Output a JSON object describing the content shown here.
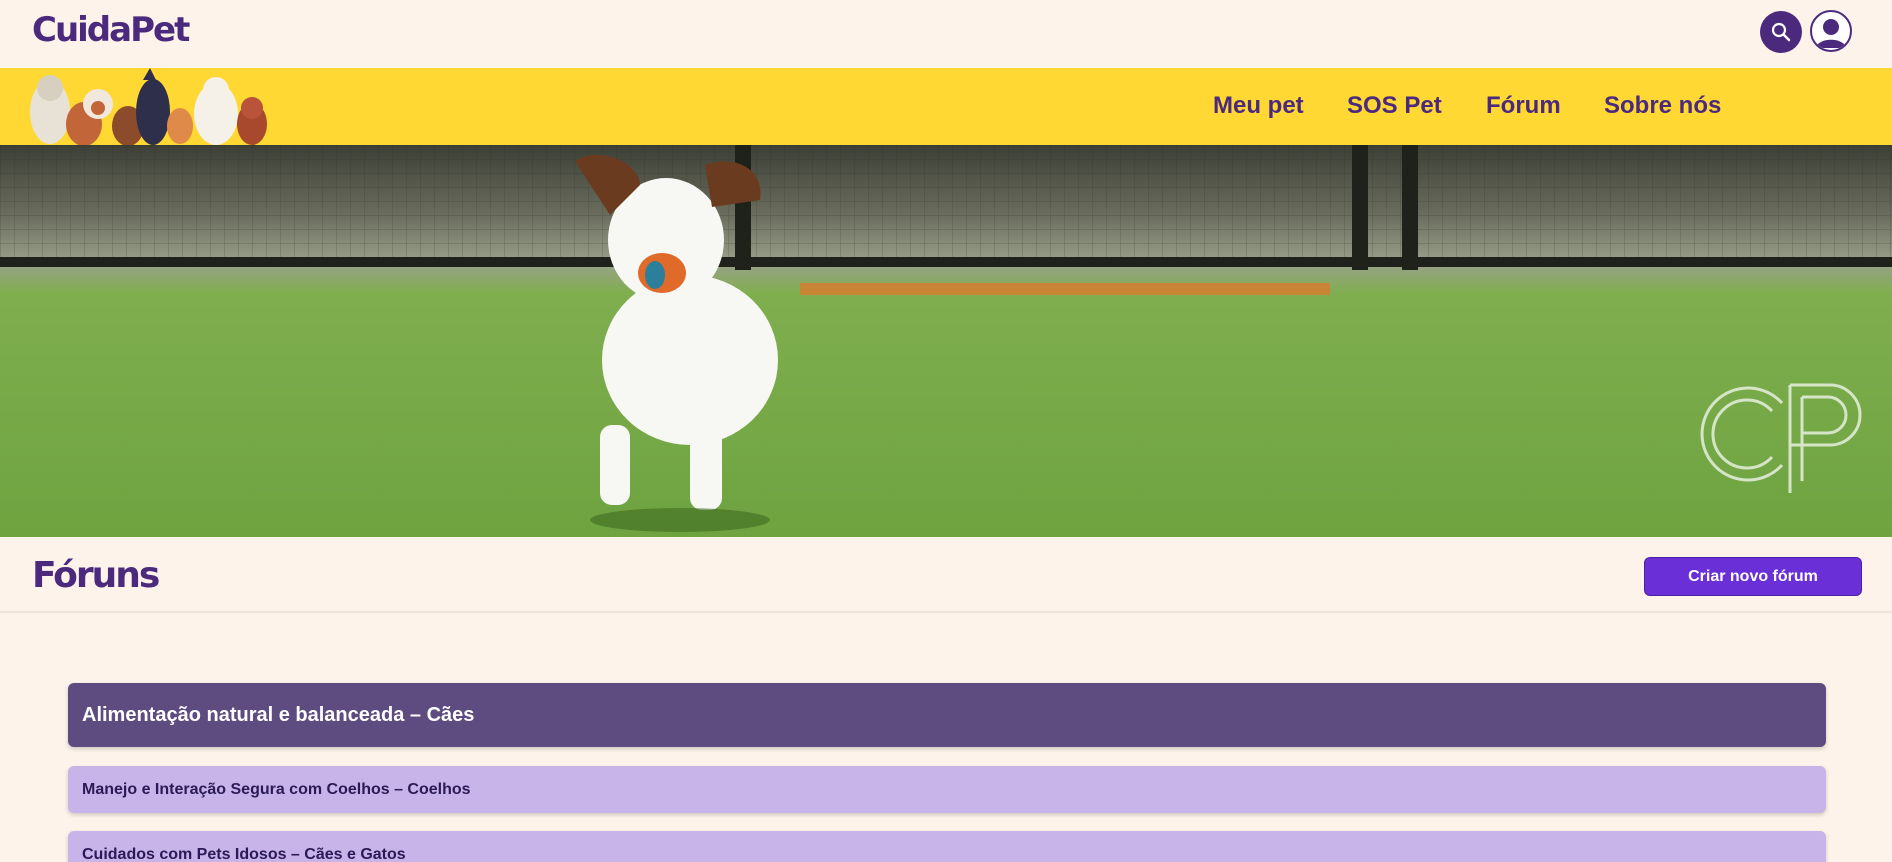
{
  "brand": {
    "logo_text": "CuidaPet"
  },
  "header": {
    "search_icon": "search-icon",
    "user_icon": "user-avatar-icon"
  },
  "nav": {
    "items": [
      {
        "label": "Meu pet"
      },
      {
        "label": "SOS Pet"
      },
      {
        "label": "Fórum"
      },
      {
        "label": "Sobre nós"
      }
    ]
  },
  "hero": {
    "watermark_text": "CP"
  },
  "page": {
    "title": "Fóruns",
    "create_button": "Criar novo fórum"
  },
  "forums": [
    {
      "title": "Alimentação natural e balanceada – Cães",
      "active": true
    },
    {
      "title": "Manejo e Interação Segura com Coelhos – Coelhos",
      "active": false
    },
    {
      "title": "Cuidados com Pets Idosos – Cães e Gatos",
      "active": false
    }
  ],
  "colors": {
    "brand_purple": "#4b2a7e",
    "nav_yellow": "#ffd833",
    "page_bg": "#fdf3ea",
    "button_purple": "#6a2fd6",
    "forum_active": "#5e4b7f",
    "forum_item": "#c8b4e8"
  }
}
